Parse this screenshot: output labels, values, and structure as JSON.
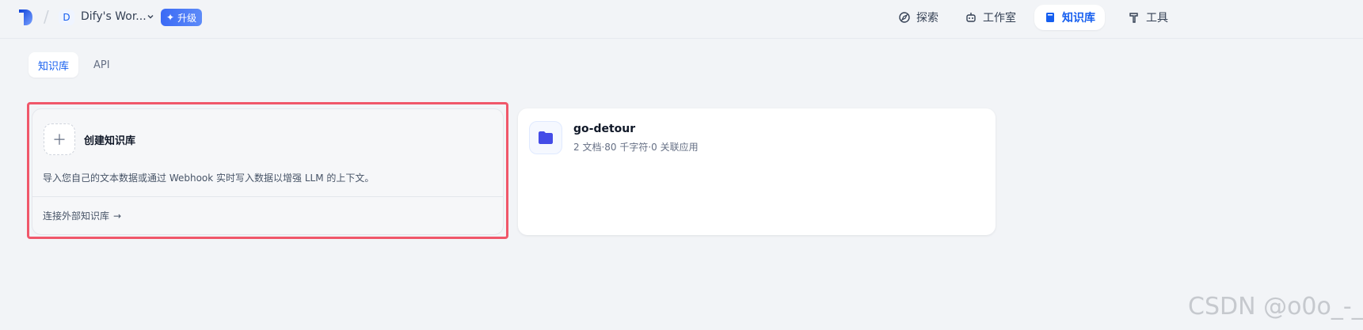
{
  "header": {
    "workspace_initial": "D",
    "workspace_name": "Dify's Wor...",
    "upgrade_label": "升级",
    "nav": [
      {
        "label": "探索",
        "icon": "explore-icon"
      },
      {
        "label": "工作室",
        "icon": "robot-icon"
      },
      {
        "label": "知识库",
        "icon": "book-icon",
        "active": true
      },
      {
        "label": "工具",
        "icon": "hammer-icon"
      }
    ]
  },
  "tabs": [
    {
      "label": "知识库",
      "active": true
    },
    {
      "label": "API",
      "active": false
    }
  ],
  "create_card": {
    "title": "创建知识库",
    "description": "导入您自己的文本数据或通过 Webhook 实时写入数据以增强 LLM 的上下文。",
    "external_link": "连接外部知识库",
    "arrow": "→"
  },
  "datasets": [
    {
      "name": "go-detour",
      "meta": "2 文档·80 千字符·0 关联应用"
    }
  ],
  "watermark": "CSDN @o0o_-_",
  "colors": {
    "accent": "#155eef",
    "highlight": "#f0576a",
    "folder": "#444ce7"
  }
}
